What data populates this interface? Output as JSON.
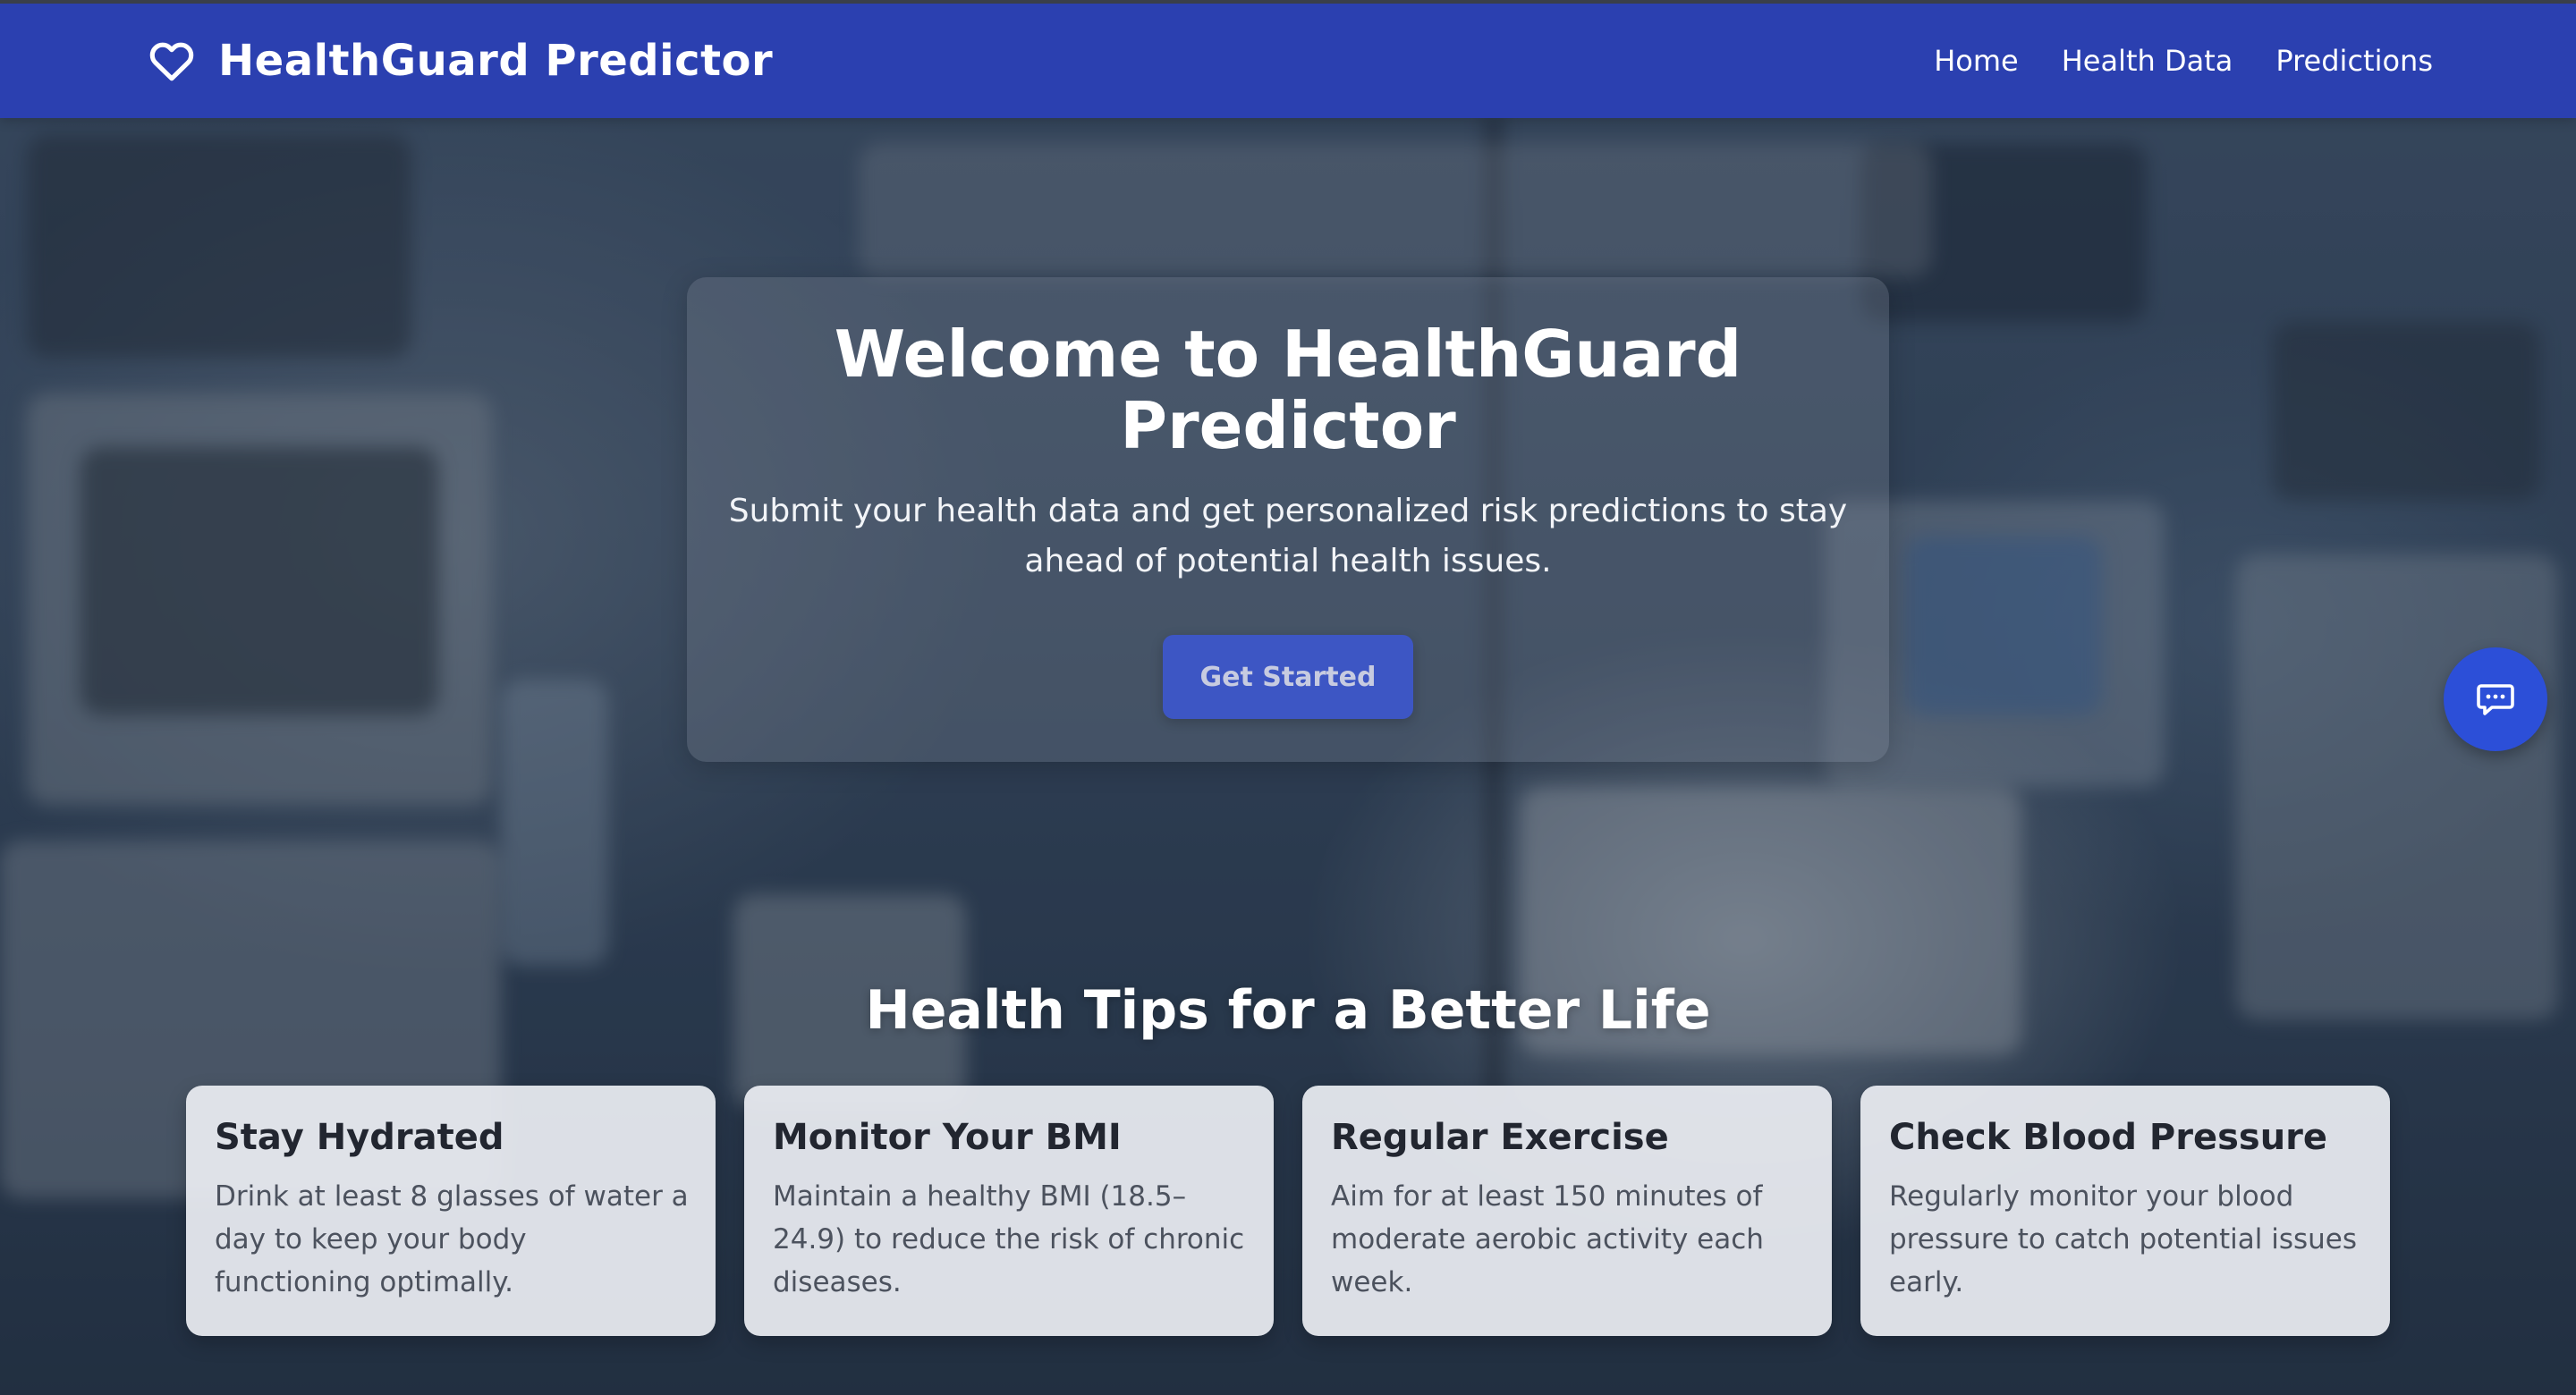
{
  "navbar": {
    "brand_title": "HealthGuard Predictor",
    "brand_icon": "heart-outline-icon",
    "links": [
      "Home",
      "Health Data",
      "Predictions"
    ]
  },
  "hero": {
    "title": "Welcome to HealthGuard Predictor",
    "subtitle": "Submit your health data and get personalized risk predictions to stay ahead of potential health issues.",
    "button_label": "Get Started"
  },
  "chat": {
    "icon": "chat-bubble-icon"
  },
  "tips": {
    "heading": "Health Tips for a Better Life",
    "items": [
      {
        "title": "Stay Hydrated",
        "text": "Drink at least 8 glasses of water a day to keep your body functioning optimally."
      },
      {
        "title": "Monitor Your BMI",
        "text": "Maintain a healthy BMI (18.5–24.9) to reduce the risk of chronic diseases."
      },
      {
        "title": "Regular Exercise",
        "text": "Aim for at least 150 minutes of moderate aerobic activity each week."
      },
      {
        "title": "Check Blood Pressure",
        "text": "Regularly monitor your blood pressure to catch potential issues early."
      }
    ]
  },
  "colors": {
    "navbar": "#2b40b0",
    "primary_button": "#3d56c4",
    "chat_button": "#2c4fd8",
    "card_background": "#ebedf2"
  }
}
